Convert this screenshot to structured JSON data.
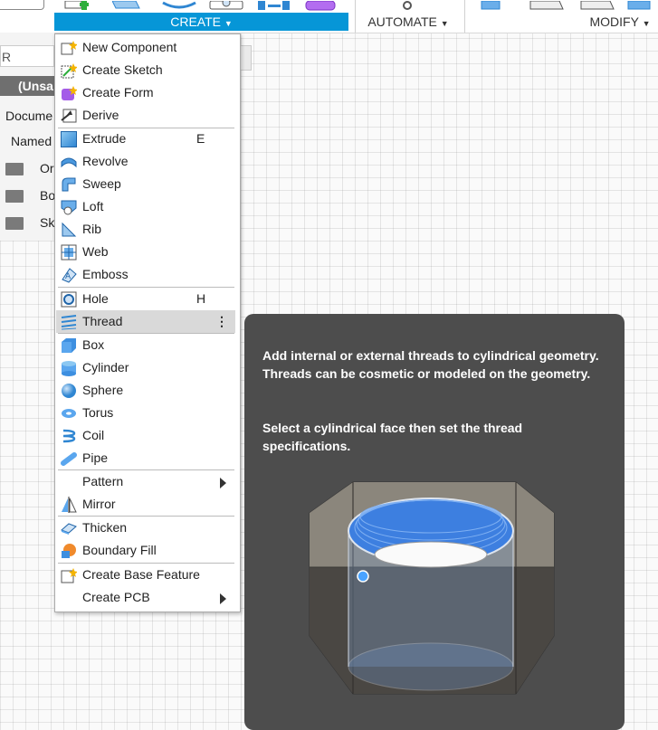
{
  "toolbar": {
    "groups": [
      "CREATE",
      "AUTOMATE",
      "MODIFY"
    ]
  },
  "browser": {
    "search_fragment": "R",
    "doc_title": "(Unsa",
    "rows": [
      "Docume",
      "Named",
      "Or",
      "Bo",
      "Sk"
    ]
  },
  "menu": {
    "items": [
      {
        "label": "New Component",
        "icon": "new-component-icon"
      },
      {
        "label": "Create Sketch",
        "icon": "create-sketch-icon"
      },
      {
        "label": "Create Form",
        "icon": "create-form-icon"
      },
      {
        "label": "Derive",
        "icon": "derive-icon"
      },
      {
        "label": "Extrude",
        "shortcut": "E",
        "icon": "extrude-icon"
      },
      {
        "label": "Revolve",
        "icon": "revolve-icon"
      },
      {
        "label": "Sweep",
        "icon": "sweep-icon"
      },
      {
        "label": "Loft",
        "icon": "loft-icon"
      },
      {
        "label": "Rib",
        "icon": "rib-icon"
      },
      {
        "label": "Web",
        "icon": "web-icon"
      },
      {
        "label": "Emboss",
        "icon": "emboss-icon"
      },
      {
        "label": "Hole",
        "shortcut": "H",
        "icon": "hole-icon"
      },
      {
        "label": "Thread",
        "icon": "thread-icon",
        "more": "⋮"
      },
      {
        "label": "Box",
        "icon": "box-icon"
      },
      {
        "label": "Cylinder",
        "icon": "cylinder-icon"
      },
      {
        "label": "Sphere",
        "icon": "sphere-icon"
      },
      {
        "label": "Torus",
        "icon": "torus-icon"
      },
      {
        "label": "Coil",
        "icon": "coil-icon"
      },
      {
        "label": "Pipe",
        "icon": "pipe-icon"
      },
      {
        "label": "Pattern",
        "icon": "none"
      },
      {
        "label": "Mirror",
        "icon": "mirror-icon"
      },
      {
        "label": "Thicken",
        "icon": "thicken-icon"
      },
      {
        "label": "Boundary Fill",
        "icon": "boundary-fill-icon"
      },
      {
        "label": "Create Base Feature",
        "icon": "base-feature-icon"
      },
      {
        "label": "Create PCB",
        "icon": "none"
      }
    ]
  },
  "tooltip": {
    "description": "Add internal or external threads to cylindrical geometry. Threads can be cosmetic or modeled on the geometry.",
    "instruction": "Select a cylindrical face then set the thread specifications.",
    "image": "threaded-nut-illustration"
  },
  "colors": {
    "accent": "#0696d7",
    "tooltip_bg": "#4d4d4d",
    "highlight": "#d9d9d9",
    "thread_blue": "#3d7fe0"
  }
}
